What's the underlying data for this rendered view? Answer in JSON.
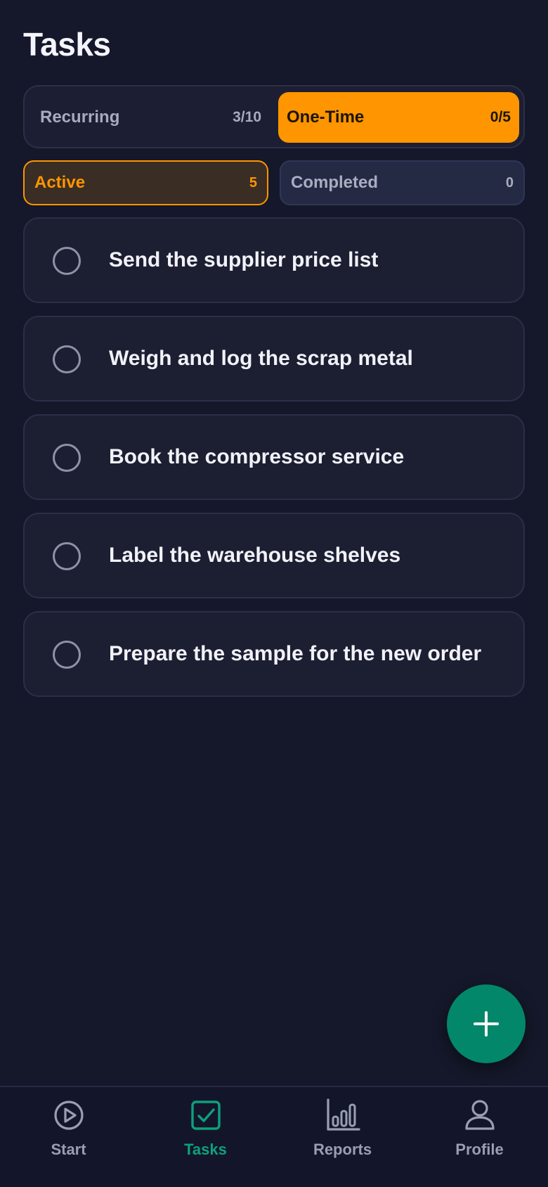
{
  "header": {
    "title": "Tasks"
  },
  "segment": {
    "recurring": {
      "label": "Recurring",
      "count": "3/10"
    },
    "one_time": {
      "label": "One-Time",
      "count": "0/5"
    },
    "selected": "one_time"
  },
  "filters": {
    "active": {
      "label": "Active",
      "count": "5"
    },
    "completed": {
      "label": "Completed",
      "count": "0"
    },
    "selected": "active"
  },
  "tasks": [
    {
      "text": "Send the supplier price list",
      "done": false
    },
    {
      "text": "Weigh and log the scrap metal",
      "done": false
    },
    {
      "text": "Book the compressor service",
      "done": false
    },
    {
      "text": "Label the warehouse shelves",
      "done": false
    },
    {
      "text": "Prepare the sample for the new order",
      "done": false
    }
  ],
  "fab": {
    "icon": "plus-icon"
  },
  "nav": {
    "items": [
      {
        "label": "Start",
        "icon": "play-circle-icon"
      },
      {
        "label": "Tasks",
        "icon": "check-square-icon"
      },
      {
        "label": "Reports",
        "icon": "bar-chart-icon"
      },
      {
        "label": "Profile",
        "icon": "user-icon"
      }
    ],
    "active": "Tasks"
  },
  "colors": {
    "background": "#15182a",
    "accent_orange": "#ff9500",
    "accent_green": "#0ea07c",
    "fab": "#02876a"
  }
}
